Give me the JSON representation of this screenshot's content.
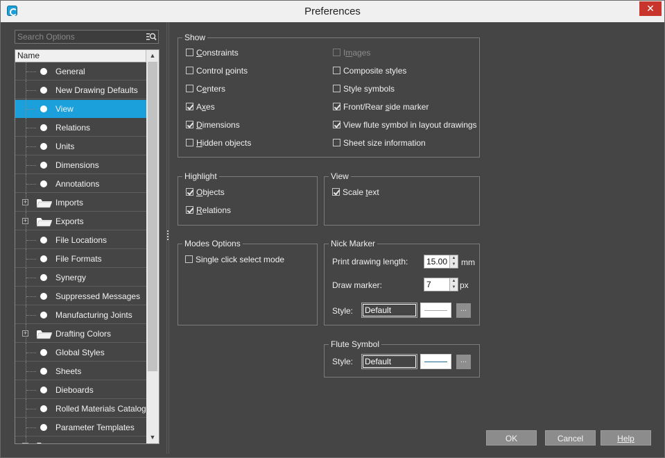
{
  "window": {
    "title": "Preferences",
    "close_glyph": "✕"
  },
  "search": {
    "placeholder": "Search Options",
    "icon": "search-icon"
  },
  "tree": {
    "header": "Name",
    "items": [
      {
        "label": "General",
        "type": "leaf"
      },
      {
        "label": "New Drawing Defaults",
        "type": "leaf"
      },
      {
        "label": "View",
        "type": "leaf",
        "selected": true
      },
      {
        "label": "Relations",
        "type": "leaf"
      },
      {
        "label": "Units",
        "type": "leaf"
      },
      {
        "label": "Dimensions",
        "type": "leaf"
      },
      {
        "label": "Annotations",
        "type": "leaf"
      },
      {
        "label": "Imports",
        "type": "folder"
      },
      {
        "label": "Exports",
        "type": "folder"
      },
      {
        "label": "File Locations",
        "type": "leaf"
      },
      {
        "label": "File Formats",
        "type": "leaf"
      },
      {
        "label": "Synergy",
        "type": "leaf"
      },
      {
        "label": "Suppressed Messages",
        "type": "leaf"
      },
      {
        "label": "Manufacturing Joints",
        "type": "leaf"
      },
      {
        "label": "Drafting Colors",
        "type": "folder"
      },
      {
        "label": "Global Styles",
        "type": "leaf"
      },
      {
        "label": "Sheets",
        "type": "leaf"
      },
      {
        "label": "Dieboards",
        "type": "leaf"
      },
      {
        "label": "Rolled Materials Catalog",
        "type": "leaf"
      },
      {
        "label": "Parameter Templates",
        "type": "leaf"
      },
      {
        "label": "",
        "type": "folder"
      }
    ],
    "selected_color": "#1ba0dc"
  },
  "show": {
    "title": "Show",
    "left": [
      {
        "pre": "",
        "u": "C",
        "post": "onstraints",
        "checked": false
      },
      {
        "pre": "Control ",
        "u": "p",
        "post": "oints",
        "checked": false
      },
      {
        "pre": "C",
        "u": "e",
        "post": "nters",
        "checked": false
      },
      {
        "pre": "A",
        "u": "x",
        "post": "es",
        "checked": true
      },
      {
        "pre": "",
        "u": "D",
        "post": "imensions",
        "checked": true
      },
      {
        "pre": "",
        "u": "H",
        "post": "idden objects",
        "checked": false
      }
    ],
    "right": [
      {
        "pre": "I",
        "u": "m",
        "post": "ages",
        "checked": false,
        "disabled": true
      },
      {
        "pre": "Composite styles",
        "u": "",
        "post": "",
        "checked": false
      },
      {
        "pre": "Style symbols",
        "u": "",
        "post": "",
        "checked": false
      },
      {
        "pre": "Front/Rear ",
        "u": "s",
        "post": "ide marker",
        "checked": true
      },
      {
        "pre": "View flute symbol in layout drawings",
        "u": "",
        "post": "",
        "checked": true
      },
      {
        "pre": "Sheet size information",
        "u": "",
        "post": "",
        "checked": false
      }
    ]
  },
  "highlight": {
    "title": "Highlight",
    "items": [
      {
        "pre": "",
        "u": "O",
        "post": "bjects",
        "checked": true
      },
      {
        "pre": "",
        "u": "R",
        "post": "elations",
        "checked": true
      }
    ]
  },
  "view": {
    "title": "View",
    "items": [
      {
        "pre": "Scale ",
        "u": "t",
        "post": "ext",
        "checked": true
      }
    ]
  },
  "modes": {
    "title": "Modes Options",
    "items": [
      {
        "pre": "Single click select mode",
        "u": "",
        "post": "",
        "checked": false
      }
    ]
  },
  "nick": {
    "title": "Nick Marker",
    "print_label": "Print drawing length:",
    "print_value": "15.00",
    "print_unit": "mm",
    "draw_label": "Draw marker:",
    "draw_value": "7",
    "draw_unit": "px",
    "style_label": "Style:",
    "style_value": "Default",
    "line_color": "#aaaaaa",
    "more_label": "..."
  },
  "flute": {
    "title": "Flute Symbol",
    "style_label": "Style:",
    "style_value": "Default",
    "line_color": "#1a6a90",
    "more_label": "..."
  },
  "buttons": {
    "ok": "OK",
    "cancel": "Cancel",
    "help": "Help"
  }
}
